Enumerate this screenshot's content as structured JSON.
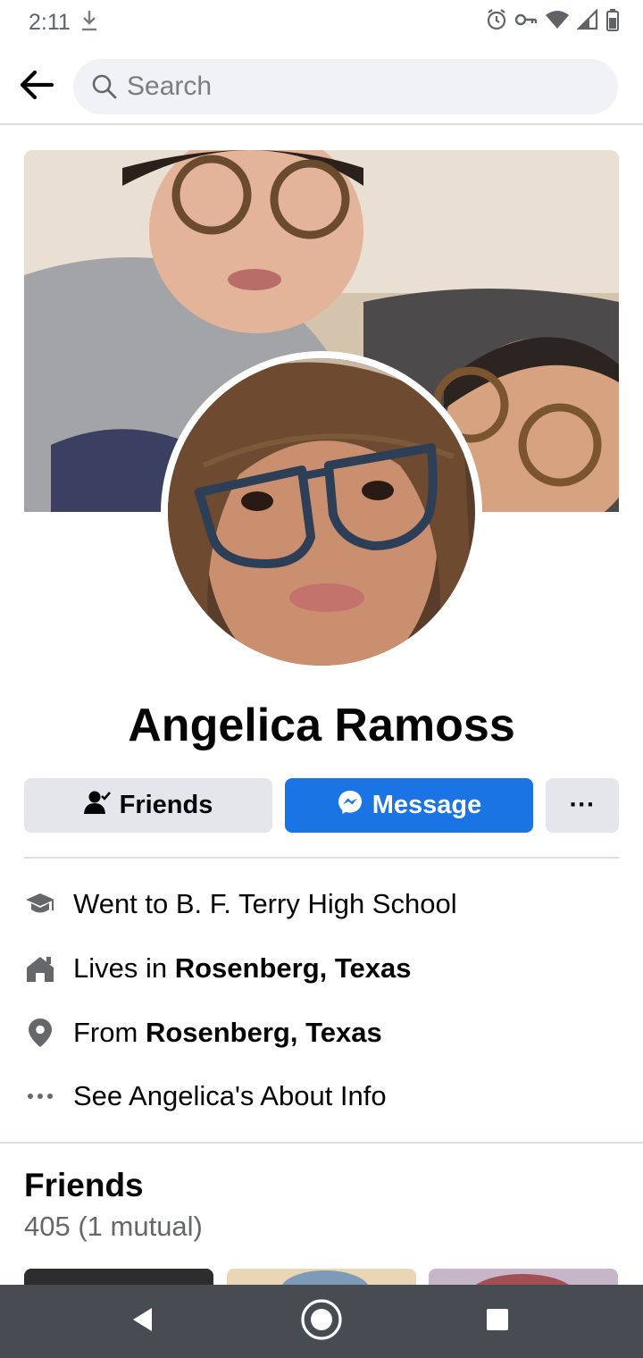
{
  "status_bar": {
    "time": "2:11"
  },
  "search": {
    "placeholder": "Search"
  },
  "profile": {
    "name": "Angelica Ramoss"
  },
  "actions": {
    "friends_label": "Friends",
    "message_label": "Message",
    "more_label": "···"
  },
  "intro": {
    "school": {
      "prefix": "Went to B. F. Terry High School"
    },
    "lives_in": {
      "prefix": "Lives in ",
      "place": "Rosenberg, Texas"
    },
    "from": {
      "prefix": "From ",
      "place": "Rosenberg, Texas"
    },
    "about": {
      "label": "See Angelica's About Info"
    }
  },
  "friends_section": {
    "title": "Friends",
    "count": "405 (1 mutual)"
  },
  "colors": {
    "accent": "#1b74e4",
    "nav_bar": "#474c52",
    "secondary_text": "#65676b"
  }
}
